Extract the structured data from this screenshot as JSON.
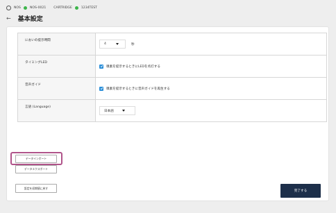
{
  "status_bar": {
    "nos1": "NOS",
    "nos2": "NOS-0021",
    "cartridge": "CARTRIDGE",
    "test": "1234TEST",
    "dot_color": "#3cb54a"
  },
  "header": {
    "title": "基本設定"
  },
  "settings": {
    "odor_time": {
      "label": "においの提示時間",
      "value": "4",
      "unit": "秒"
    },
    "timing_led": {
      "label": "タイミングLED",
      "checkbox_text": "嗅素を提示するときにLEDを点灯する",
      "checked": true
    },
    "voice_guide": {
      "label": "音声ガイド",
      "checkbox_text": "嗅素を提示するときに音声ガイドを再生する",
      "checked": true
    },
    "language": {
      "label": "言語 (Language)",
      "value": "日本語"
    }
  },
  "buttons": {
    "data_import": "データインポート",
    "data_export": "データエクスポート",
    "reset": "設定を初期値に戻す",
    "finish": "完了する"
  },
  "colors": {
    "accent": "#2a8ed8",
    "primary_button": "#1d2f4a",
    "highlight": "#b0548a"
  }
}
